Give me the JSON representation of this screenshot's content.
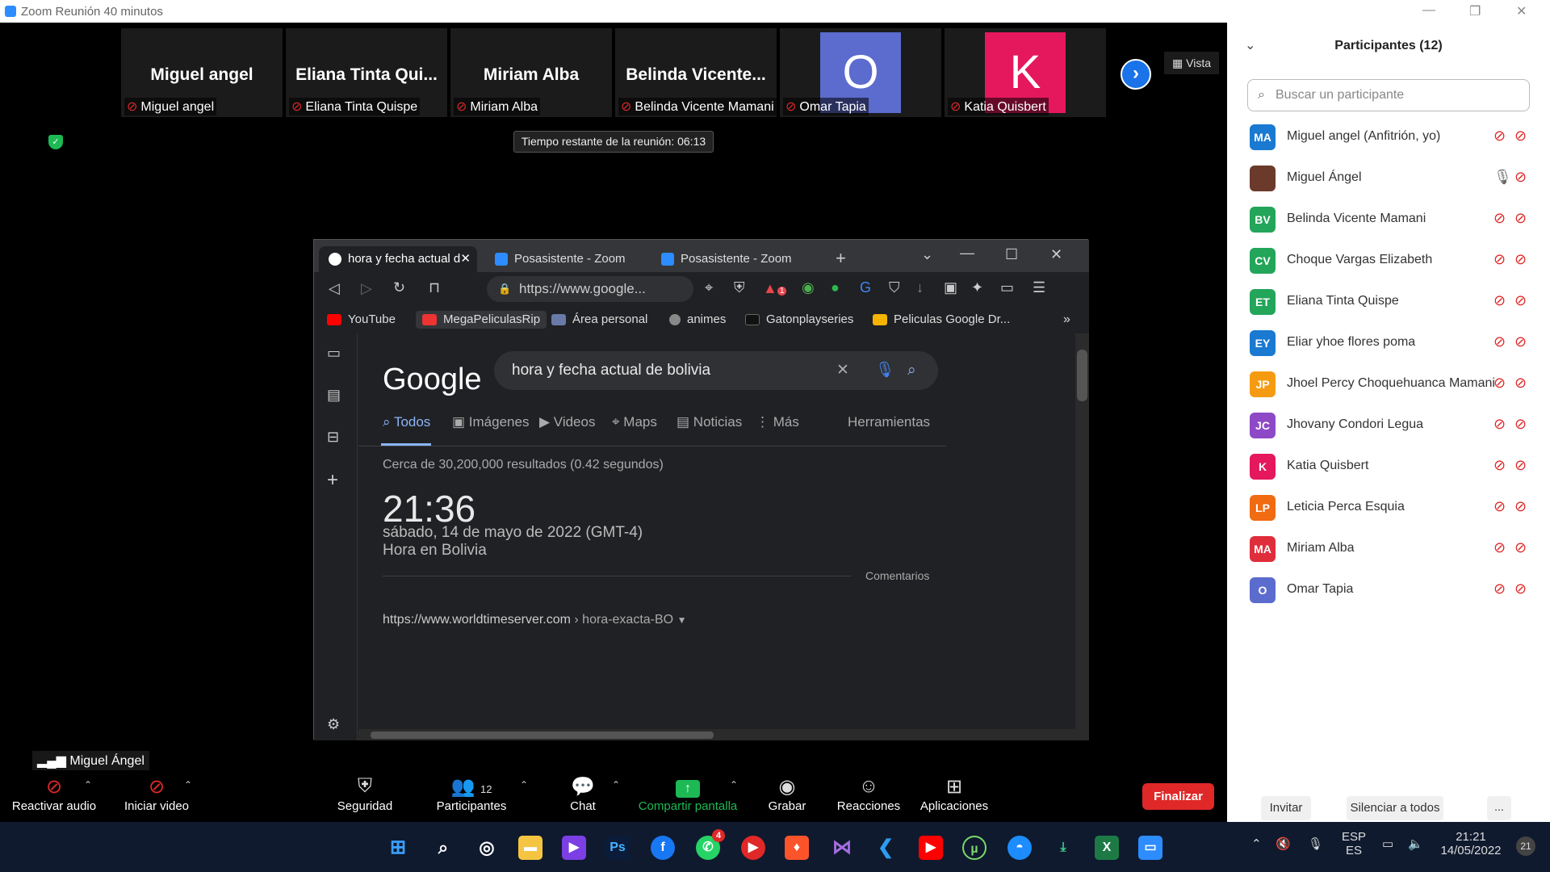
{
  "window": {
    "title": "Zoom Reunión 40 minutos"
  },
  "gallery": {
    "tiles": [
      {
        "name": "Miguel angel",
        "label": "Miguel angel"
      },
      {
        "name": "Eliana  Tinta  Qui...",
        "label": "Eliana Tinta Quispe"
      },
      {
        "name": "Miriam Alba",
        "label": "Miriam Alba"
      },
      {
        "name": "Belinda  Vicente...",
        "label": "Belinda Vicente Mamani"
      },
      {
        "avatar": "O",
        "avatar_color": "#5b6bce",
        "label": "Omar Tapia"
      },
      {
        "avatar": "K",
        "avatar_color": "#e5175d",
        "label": "Katia Quisbert"
      }
    ],
    "view_label": "Vista"
  },
  "timer": "Tiempo restante de la reunión: 06:13",
  "browser": {
    "tabs": [
      {
        "title": "hora y fecha actual d"
      },
      {
        "title": "Posasistente - Zoom"
      },
      {
        "title": "Posasistente - Zoom"
      }
    ],
    "url": "https://www.google...",
    "shield_badge": "1",
    "bookmarks": [
      {
        "label": "YouTube"
      },
      {
        "label": "MegaPeliculasRip"
      },
      {
        "label": "Área personal"
      },
      {
        "label": "animes"
      },
      {
        "label": "Gatonplayseries"
      },
      {
        "label": "Peliculas Google Dr..."
      }
    ],
    "google": {
      "logo": "Google",
      "query": "hora y fecha actual de bolivia",
      "tabs": [
        "Todos",
        "Imágenes",
        "Videos",
        "Maps",
        "Noticias",
        "Más"
      ],
      "tools": "Herramientas",
      "result_count": "Cerca de 30,200,000 resultados (0.42 segundos)",
      "time": "21:36",
      "date": "sábado, 14 de mayo de 2022 (GMT-4)",
      "zone": "Hora en Bolivia",
      "feedback": "Comentarios",
      "link": "https://www.worldtimeserver.com",
      "link_path": "› hora-exacta-BO"
    }
  },
  "active_speaker": "Miguel Ángel",
  "toolbar": {
    "audio": "Reactivar audio",
    "video": "Iniciar video",
    "security": "Seguridad",
    "participants": "Participantes",
    "participants_count": "12",
    "chat": "Chat",
    "share": "Compartir pantalla",
    "record": "Grabar",
    "reactions": "Reacciones",
    "apps": "Aplicaciones",
    "end": "Finalizar"
  },
  "participants_panel": {
    "title": "Participantes (12)",
    "search_placeholder": "Buscar un participante",
    "list": [
      {
        "initials": "MA",
        "color": "#1a79d1",
        "name": "Miguel angel (Anfitrión, yo)",
        "mic": "muted"
      },
      {
        "initials": "",
        "color": "#6b3a2a",
        "name": "Miguel Ángel",
        "mic": "on"
      },
      {
        "initials": "BV",
        "color": "#23a55a",
        "name": "Belinda Vicente Mamani",
        "mic": "muted"
      },
      {
        "initials": "CV",
        "color": "#23a55a",
        "name": "Choque Vargas   Elizabeth",
        "mic": "muted"
      },
      {
        "initials": "ET",
        "color": "#23a55a",
        "name": "Eliana Tinta Quispe",
        "mic": "muted"
      },
      {
        "initials": "EY",
        "color": "#1a79d1",
        "name": "Eliar yhoe flores poma",
        "mic": "muted"
      },
      {
        "initials": "JP",
        "color": "#f59b12",
        "name": "Jhoel Percy Choquehuanca Mamani",
        "mic": "muted"
      },
      {
        "initials": "JC",
        "color": "#8e49c7",
        "name": "Jhovany Condori Legua",
        "mic": "muted"
      },
      {
        "initials": "K",
        "color": "#e5175d",
        "name": "Katia Quisbert",
        "mic": "muted"
      },
      {
        "initials": "LP",
        "color": "#f06b12",
        "name": "Leticia Perca Esquia",
        "mic": "muted"
      },
      {
        "initials": "MA",
        "color": "#e02d3b",
        "name": "Miriam Alba",
        "mic": "muted"
      },
      {
        "initials": "O",
        "color": "#5b6bce",
        "name": "Omar Tapia",
        "mic": "muted"
      }
    ],
    "invite": "Invitar",
    "mute_all": "Silenciar a todos",
    "more": "..."
  },
  "taskbar": {
    "whatsapp_badge": "4",
    "lang_top": "ESP",
    "lang_bottom": "ES",
    "clock_time": "21:21",
    "clock_date": "14/05/2022",
    "notif": "21"
  }
}
